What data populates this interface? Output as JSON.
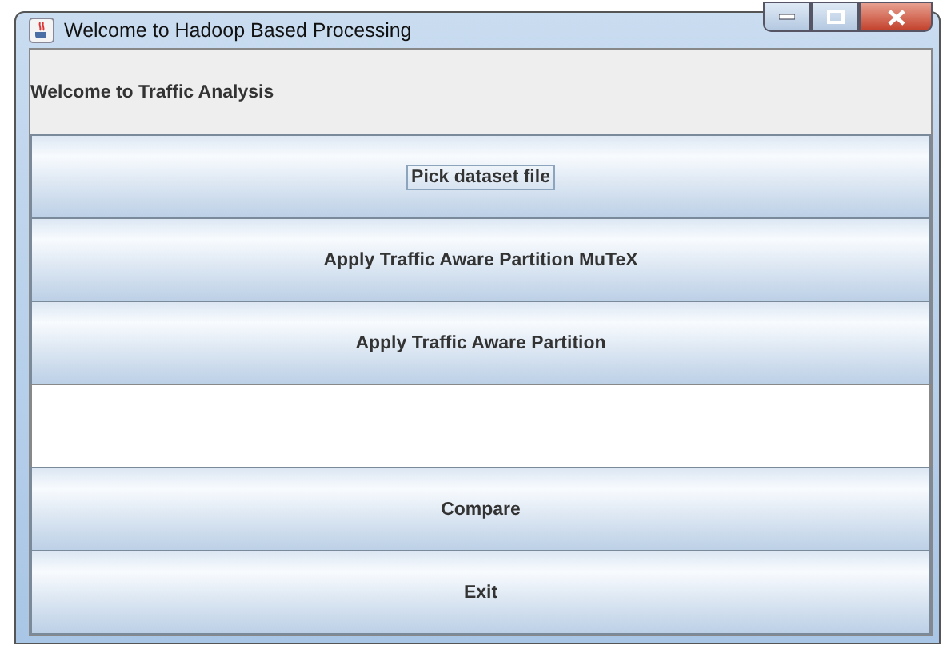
{
  "window": {
    "title": "Welcome to Hadoop Based Processing"
  },
  "heading": "Welcome to Traffic Analysis",
  "rows": [
    {
      "kind": "button",
      "label": "Pick dataset file",
      "focused": true
    },
    {
      "kind": "button",
      "label": "Apply Traffic Aware Partition MuTeX",
      "focused": false
    },
    {
      "kind": "button",
      "label": "Apply Traffic Aware Partition",
      "focused": false
    },
    {
      "kind": "textarea"
    },
    {
      "kind": "button",
      "label": "Compare",
      "focused": false
    },
    {
      "kind": "button",
      "label": "Exit",
      "focused": false
    }
  ]
}
